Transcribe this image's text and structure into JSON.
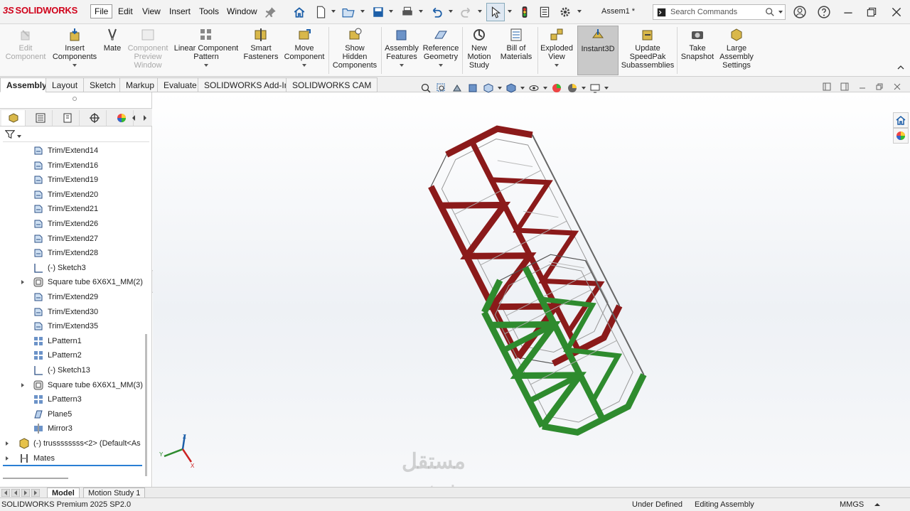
{
  "app": {
    "brand": "SOLIDWORKS",
    "doc_title": "Assem1 *"
  },
  "menus": [
    "File",
    "Edit",
    "View",
    "Insert",
    "Tools",
    "Window"
  ],
  "search": {
    "placeholder": "Search Commands"
  },
  "ribbon": {
    "buttons": [
      {
        "label": "Edit\nComponent",
        "icon": "edit-component-icon",
        "disabled": true
      },
      {
        "label": "Insert\nComponents",
        "icon": "insert-components-icon"
      },
      {
        "label": "Mate",
        "icon": "mate-icon"
      },
      {
        "label": "Component\nPreview\nWindow",
        "icon": "component-preview-icon",
        "disabled": true
      },
      {
        "label": "Linear Component\nPattern",
        "icon": "linear-pattern-icon"
      },
      {
        "label": "Smart\nFasteners",
        "icon": "smart-fasteners-icon"
      },
      {
        "label": "Move\nComponent",
        "icon": "move-component-icon"
      },
      {
        "label": "Show\nHidden\nComponents",
        "icon": "show-hidden-icon"
      },
      {
        "label": "Assembly\nFeatures",
        "icon": "assembly-features-icon"
      },
      {
        "label": "Reference\nGeometry",
        "icon": "reference-geometry-icon"
      },
      {
        "label": "New\nMotion\nStudy",
        "icon": "motion-study-icon"
      },
      {
        "label": "Bill of\nMaterials",
        "icon": "bom-icon"
      },
      {
        "label": "Exploded\nView",
        "icon": "exploded-view-icon"
      },
      {
        "label": "Instant3D",
        "icon": "instant3d-icon",
        "active": true
      },
      {
        "label": "Update\nSpeedPak\nSubassemblies",
        "icon": "speedpak-icon"
      },
      {
        "label": "Take\nSnapshot",
        "icon": "snapshot-icon"
      },
      {
        "label": "Large\nAssembly\nSettings",
        "icon": "large-assembly-icon"
      }
    ]
  },
  "command_tabs": [
    "Assembly",
    "Layout",
    "Sketch",
    "Markup",
    "Evaluate",
    "SOLIDWORKS Add-Ins",
    "SOLIDWORKS CAM"
  ],
  "tree": {
    "items": [
      {
        "label": "Trim/Extend14",
        "icon": "trim-extend-icon"
      },
      {
        "label": "Trim/Extend16",
        "icon": "trim-extend-icon"
      },
      {
        "label": "Trim/Extend19",
        "icon": "trim-extend-icon"
      },
      {
        "label": "Trim/Extend20",
        "icon": "trim-extend-icon"
      },
      {
        "label": "Trim/Extend21",
        "icon": "trim-extend-icon"
      },
      {
        "label": "Trim/Extend26",
        "icon": "trim-extend-icon"
      },
      {
        "label": "Trim/Extend27",
        "icon": "trim-extend-icon"
      },
      {
        "label": "Trim/Extend28",
        "icon": "trim-extend-icon"
      },
      {
        "label": "(-) Sketch3",
        "icon": "sketch-icon"
      },
      {
        "label": "Square tube 6X6X1_MM(2)",
        "icon": "structural-member-icon",
        "expandable": true
      },
      {
        "label": "Trim/Extend29",
        "icon": "trim-extend-icon"
      },
      {
        "label": "Trim/Extend30",
        "icon": "trim-extend-icon"
      },
      {
        "label": "Trim/Extend35",
        "icon": "trim-extend-icon"
      },
      {
        "label": "LPattern1",
        "icon": "linear-pattern-icon"
      },
      {
        "label": "LPattern2",
        "icon": "linear-pattern-icon"
      },
      {
        "label": "(-) Sketch13",
        "icon": "sketch-icon"
      },
      {
        "label": "Square tube 6X6X1_MM(3)",
        "icon": "structural-member-icon",
        "expandable": true
      },
      {
        "label": "LPattern3",
        "icon": "linear-pattern-icon"
      },
      {
        "label": "Plane5",
        "icon": "plane-icon"
      },
      {
        "label": "Mirror3",
        "icon": "mirror-icon"
      },
      {
        "label": "(-) trussssssss<2> (Default<As",
        "icon": "part-icon",
        "expandable": true,
        "root": true
      },
      {
        "label": "Mates",
        "icon": "mates-icon",
        "expandable": true,
        "root": true
      }
    ]
  },
  "bottom_tabs": [
    "Model",
    "Motion Study 1"
  ],
  "status": {
    "product": "SOLIDWORKS Premium 2025 SP2.0",
    "state": "Under Defined",
    "mode": "Editing Assembly",
    "units": "MMGS"
  },
  "triad": {
    "x": "X",
    "y": "Y",
    "z": "Z"
  },
  "watermark": {
    "arabic": "مستقل",
    "latin": "mostaql.com"
  },
  "colors": {
    "red_part": "#8b1a1a",
    "green_part": "#2e8b2e",
    "brand": "#d0021b"
  }
}
